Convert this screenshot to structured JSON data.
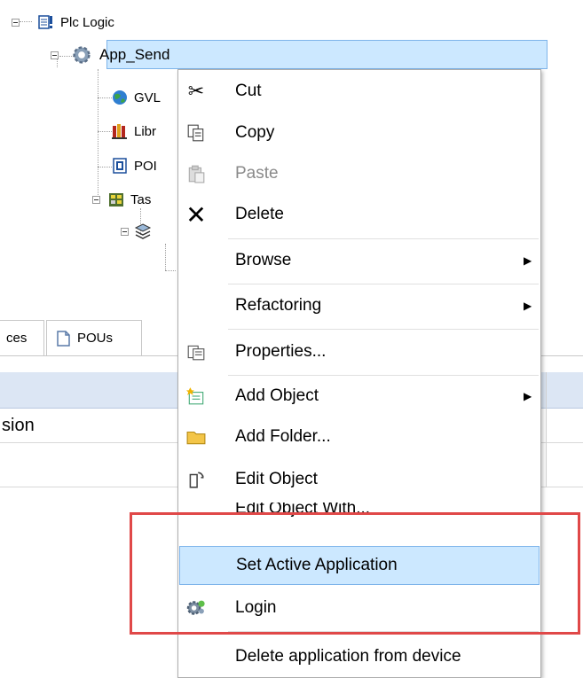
{
  "tree": {
    "root": "Plc Logic",
    "app": "App_Send",
    "children": [
      "GVL",
      "Libr",
      "POI",
      "Tas"
    ]
  },
  "panel": {
    "tab1": "ces",
    "tab2": "POUs",
    "column": "sion"
  },
  "menu": {
    "items": [
      {
        "label": "Cut",
        "icon": "scissors-icon"
      },
      {
        "label": "Copy",
        "icon": "copy-icon"
      },
      {
        "label": "Paste",
        "icon": "paste-icon",
        "disabled": true
      },
      {
        "label": "Delete",
        "icon": "delete-x-icon"
      },
      {
        "label": "Browse",
        "submenu": true
      },
      {
        "label": "Refactoring",
        "submenu": true
      },
      {
        "label": "Properties...",
        "icon": "properties-icon"
      },
      {
        "label": "Add Object",
        "icon": "add-object-icon",
        "submenu": true
      },
      {
        "label": "Add Folder...",
        "icon": "folder-icon"
      },
      {
        "label": "Edit Object",
        "icon": "edit-object-icon"
      },
      {
        "label": "Edit Object With..."
      },
      {
        "label": "Set Active Application",
        "highlighted": true
      },
      {
        "label": "Login",
        "icon": "login-gear-icon"
      },
      {
        "label": "Delete application from device"
      }
    ]
  },
  "colors": {
    "selection": "#cce8ff",
    "selection_border": "#7eb4ea",
    "annotation": "#e04848"
  }
}
